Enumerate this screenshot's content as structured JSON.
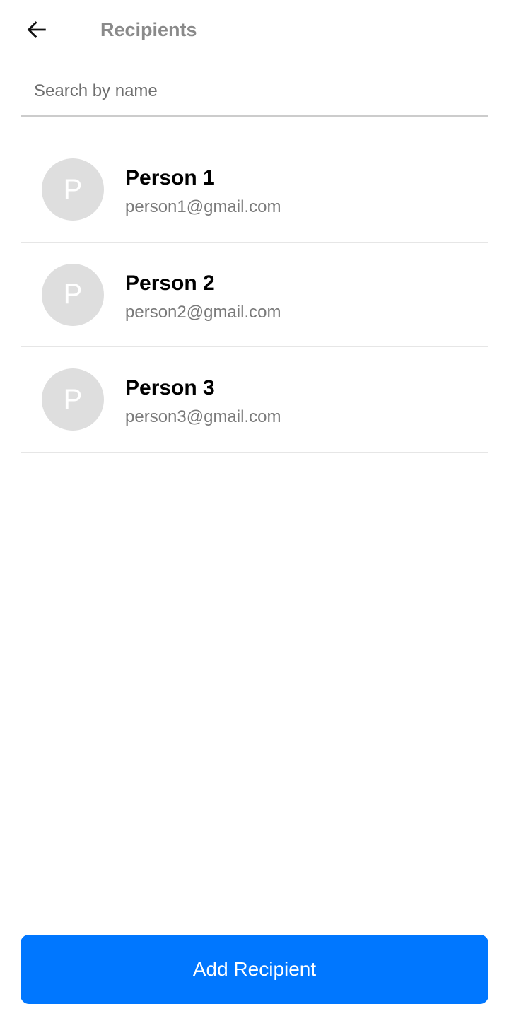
{
  "header": {
    "title": "Recipients",
    "back_icon": "arrow-left-icon"
  },
  "search": {
    "placeholder": "Search by name",
    "value": ""
  },
  "recipients": [
    {
      "initial": "P",
      "name": "Person 1",
      "email": "person1@gmail.com"
    },
    {
      "initial": "P",
      "name": "Person 2",
      "email": "person2@gmail.com"
    },
    {
      "initial": "P",
      "name": "Person 3",
      "email": "person3@gmail.com"
    }
  ],
  "footer": {
    "add_label": "Add Recipient"
  },
  "colors": {
    "accent": "#0077ff",
    "avatar_bg": "#dedede",
    "title_text": "#8a8a8a",
    "secondary_text": "#7a7a7a"
  }
}
